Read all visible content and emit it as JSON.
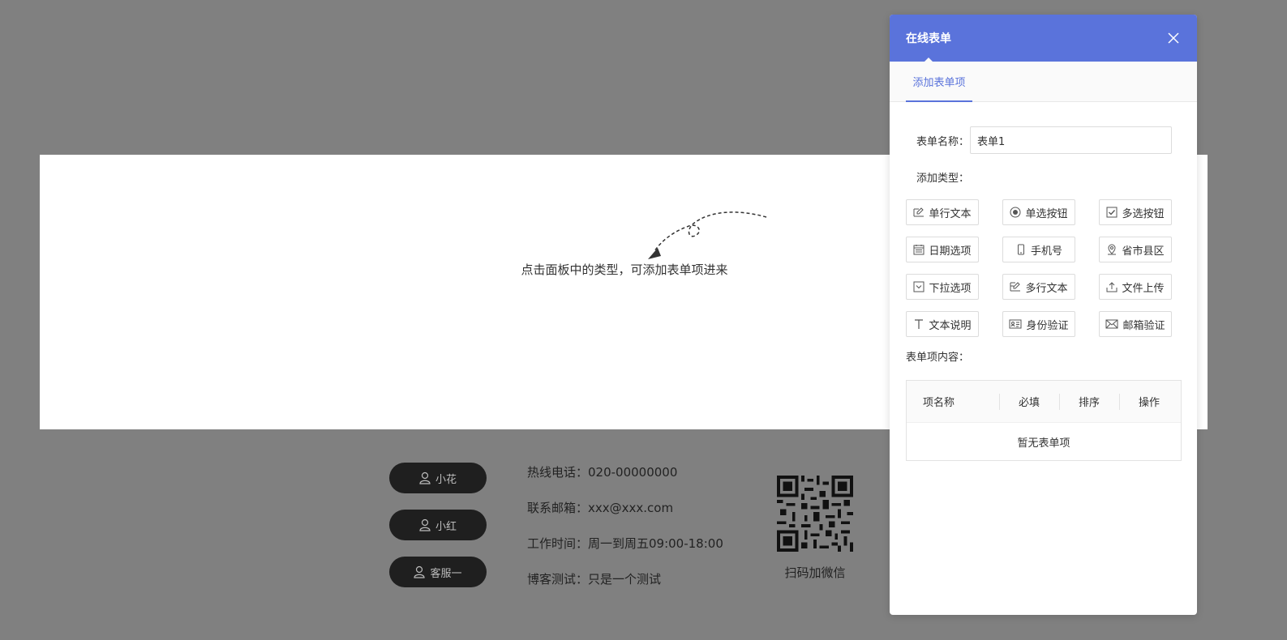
{
  "canvas": {
    "hint": "点击面板中的类型，可添加表单项进来"
  },
  "footer": {
    "service_buttons": [
      "小花",
      "小红",
      "客服一"
    ],
    "contact": {
      "hotline": "热线电话：020-00000000",
      "email": "联系邮箱：xxx@xxx.com",
      "hours": "工作时间：周一到周五09:00-18:00",
      "blog": "博客测试：只是一个测试"
    },
    "qr_caption": "扫码加微信"
  },
  "panel": {
    "title": "在线表单",
    "tab": "添加表单项",
    "name_label": "表单名称：",
    "name_value": "表单1",
    "type_label": "添加类型：",
    "types": [
      {
        "label": "单行文本",
        "icon": "single-line-text-icon"
      },
      {
        "label": "单选按钮",
        "icon": "radio-icon"
      },
      {
        "label": "多选按钮",
        "icon": "checkbox-icon"
      },
      {
        "label": "日期选项",
        "icon": "calendar-icon"
      },
      {
        "label": "手机号",
        "icon": "phone-icon"
      },
      {
        "label": "省市县区",
        "icon": "location-icon"
      },
      {
        "label": "下拉选项",
        "icon": "dropdown-icon"
      },
      {
        "label": "多行文本",
        "icon": "multi-line-text-icon"
      },
      {
        "label": "文件上传",
        "icon": "upload-icon"
      },
      {
        "label": "文本说明",
        "icon": "text-icon"
      },
      {
        "label": "身份验证",
        "icon": "id-card-icon"
      },
      {
        "label": "邮箱验证",
        "icon": "mail-icon"
      }
    ],
    "content_label": "表单项内容：",
    "table": {
      "headers": [
        "项名称",
        "必填",
        "排序",
        "操作"
      ],
      "empty": "暂无表单项"
    }
  },
  "colors": {
    "accent": "#5a73db",
    "overlay": "#808080",
    "footer_button": "#1f1f1f"
  }
}
